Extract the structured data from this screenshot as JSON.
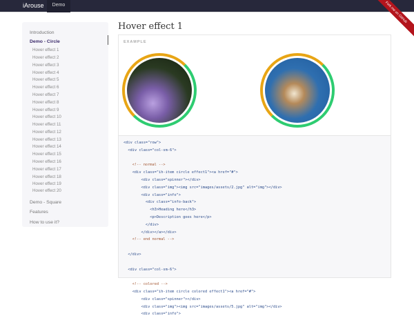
{
  "navbar": {
    "brand": "iArouse",
    "links": [
      "Demo"
    ],
    "ribbon": "Fork me on GitHub"
  },
  "sidebar": {
    "items": [
      {
        "label": "Introduction",
        "type": "top"
      },
      {
        "label": "Demo - Circle",
        "type": "active"
      },
      {
        "label": "Hover effect 1",
        "type": "sub"
      },
      {
        "label": "Hover effect 2",
        "type": "sub"
      },
      {
        "label": "Hover effect 3",
        "type": "sub"
      },
      {
        "label": "Hover effect 4",
        "type": "sub"
      },
      {
        "label": "Hover effect 5",
        "type": "sub"
      },
      {
        "label": "Hover effect 6",
        "type": "sub"
      },
      {
        "label": "Hover effect 7",
        "type": "sub"
      },
      {
        "label": "Hover effect 8",
        "type": "sub"
      },
      {
        "label": "Hover effect 9",
        "type": "sub"
      },
      {
        "label": "Hover effect 10",
        "type": "sub"
      },
      {
        "label": "Hover effect 11",
        "type": "sub"
      },
      {
        "label": "Hover effect 12",
        "type": "sub"
      },
      {
        "label": "Hover effect 13",
        "type": "sub"
      },
      {
        "label": "Hover effect 14",
        "type": "sub"
      },
      {
        "label": "Hover effect 15",
        "type": "sub"
      },
      {
        "label": "Hover effect 16",
        "type": "sub"
      },
      {
        "label": "Hover effect 17",
        "type": "sub"
      },
      {
        "label": "Hover effect 18",
        "type": "sub"
      },
      {
        "label": "Hover effect 19",
        "type": "sub"
      },
      {
        "label": "Hover effect 20",
        "type": "sub"
      },
      {
        "label": "Demo - Square",
        "type": "top"
      },
      {
        "label": "Features",
        "type": "top"
      },
      {
        "label": "How to use it?",
        "type": "top"
      }
    ]
  },
  "main": {
    "title": "Hover effect 1",
    "example_label": "EXAMPLE",
    "colors": {
      "ring_top": "#e8a515",
      "ring_bottom": "#2ecc71"
    },
    "code_lines": [
      "<div class=\"row\">",
      "  <div class=\"col-sm-6\">",
      "",
      "    <!-- normal -->",
      "    <div class=\"ih-item circle effect1\"><a href=\"#\">",
      "        <div class=\"spinner\"></div>",
      "        <div class=\"img\"><img src=\"images/assets/2.jpg\" alt=\"img\"></div>",
      "        <div class=\"info\">",
      "          <div class=\"info-back\">",
      "            <h3>Heading here</h3>",
      "            <p>Description goes here</p>",
      "          </div>",
      "        </div></a></div>",
      "    <!-- end normal -->",
      "",
      "  </div>",
      "",
      "  <div class=\"col-sm-6\">",
      "",
      "    <!-- colored -->",
      "    <div class=\"ih-item circle colored effect1\"><a href=\"#\">",
      "        <div class=\"spinner\"></div>",
      "        <div class=\"img\"><img src=\"images/assets/5.jpg\" alt=\"img\"></div>",
      "        <div class=\"info\">"
    ]
  }
}
